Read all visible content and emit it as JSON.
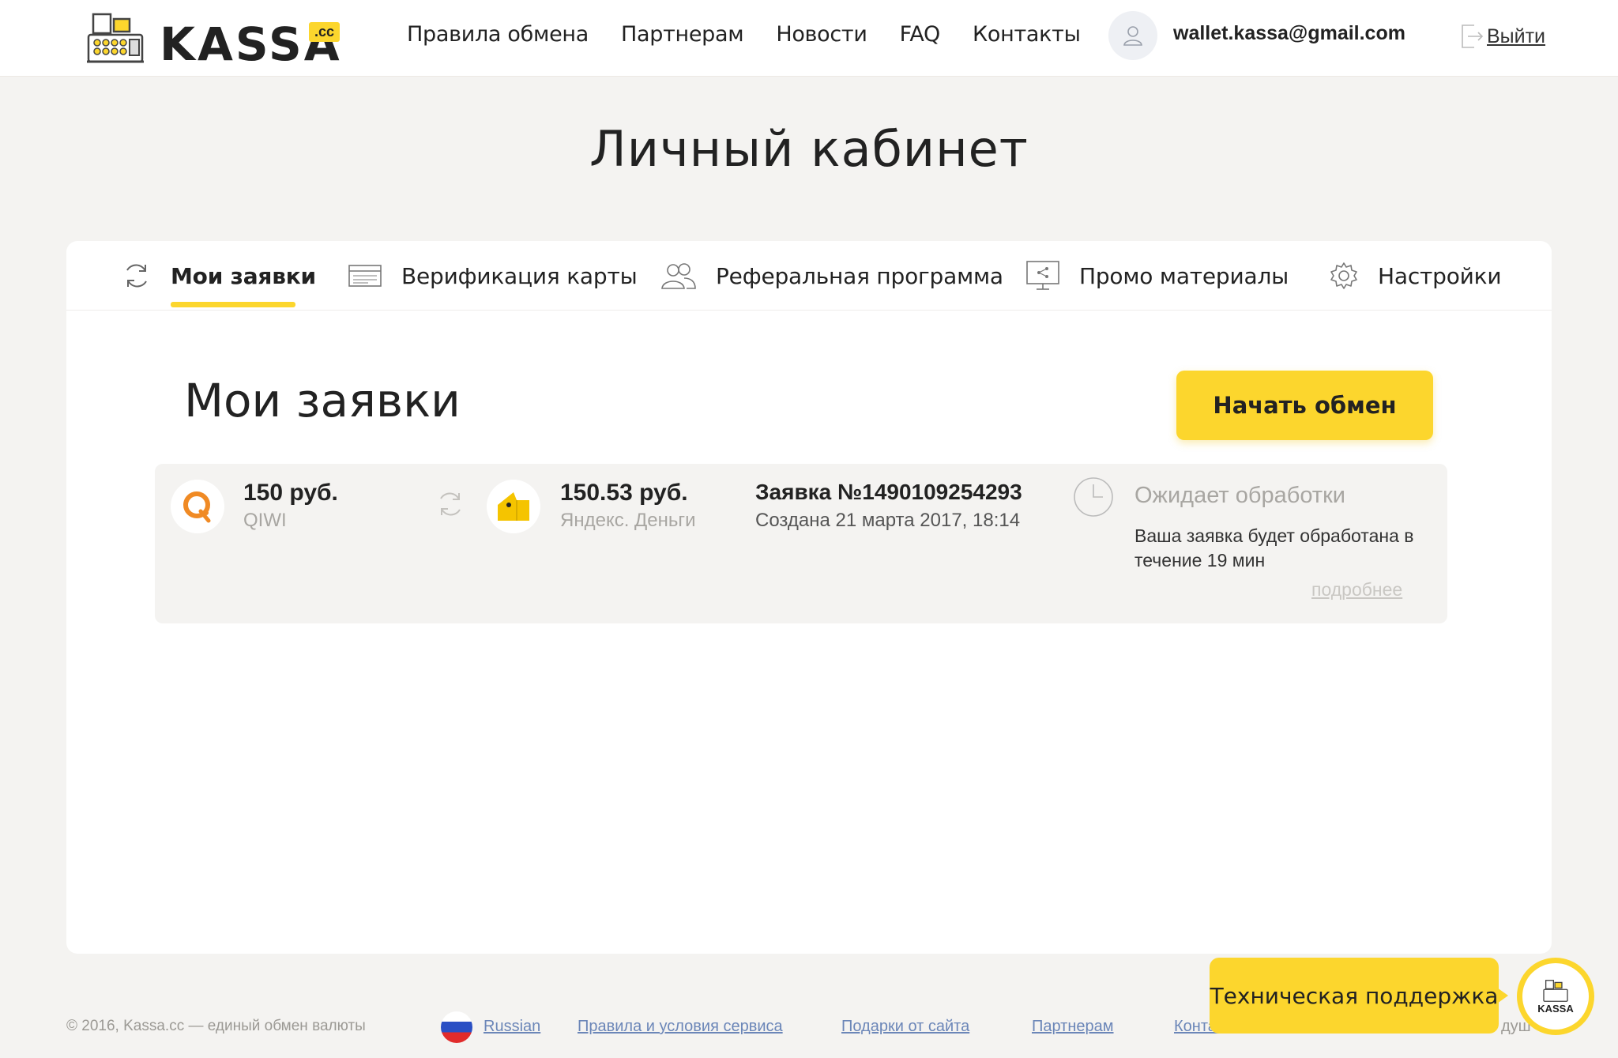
{
  "header": {
    "brand": "KASSA",
    "tld": ".cc",
    "nav": [
      {
        "label": "Правила обмена"
      },
      {
        "label": "Партнерам"
      },
      {
        "label": "Новости"
      },
      {
        "label": "FAQ"
      },
      {
        "label": "Контакты"
      }
    ],
    "user_email": "wallet.kassa@gmail.com",
    "logout_label": "Выйти"
  },
  "page_title": "Личный кабинет",
  "tabs": [
    {
      "label": "Мои заявки",
      "icon": "refresh-icon",
      "active": true
    },
    {
      "label": "Верификация карты",
      "icon": "card-icon"
    },
    {
      "label": "Реферальная программа",
      "icon": "users-icon"
    },
    {
      "label": "Промо материалы",
      "icon": "share-screen-icon"
    },
    {
      "label": "Настройки",
      "icon": "gear-icon"
    }
  ],
  "section_title": "Мои заявки",
  "start_button": "Начать обмен",
  "order": {
    "from_amount": "150 руб.",
    "from_method": "QIWI",
    "to_amount": "150.53 руб.",
    "to_method": "Яндекс. Деньги",
    "id": "Заявка №1490109254293",
    "created": "Создана 21 марта 2017, 18:14",
    "status": "Ожидает обработки",
    "status_desc": "Ваша заявка будет обработана в течение 19 мин",
    "more": "подробнее"
  },
  "footer": {
    "copyright": "© 2016, Kassa.cc — единый обмен валюты",
    "language": "Russian",
    "links": [
      {
        "label": "Правила и условия сервиса"
      },
      {
        "label": "Подарки от сайта"
      },
      {
        "label": "Партнерам"
      },
      {
        "label": "Контакты"
      }
    ],
    "trailing_text": "душ"
  },
  "support": {
    "label": "Техническая поддержка",
    "badge_text": "KASSA"
  },
  "colors": {
    "accent": "#fcd62d",
    "background": "#f4f3f1",
    "muted": "#a8a6a2",
    "qiwi": "#f08a24",
    "link": "#6b86b8"
  }
}
